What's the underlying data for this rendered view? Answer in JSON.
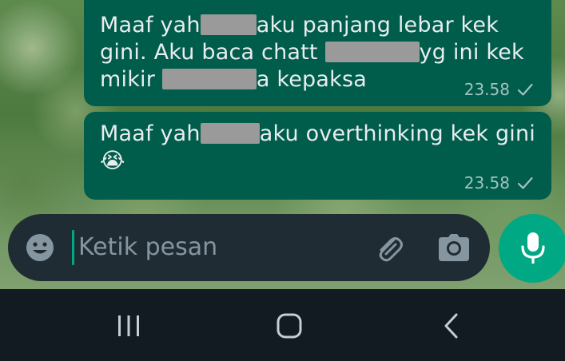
{
  "messages": [
    {
      "lines": [
        {
          "before": "Maaf yah",
          "after": "aku panjang lebar kek"
        },
        {
          "before": "gini. Aku baca chatt ",
          "after": "yg ini kek"
        },
        {
          "before": "mikir ",
          "after": "a kepaksa"
        }
      ],
      "time": "23.58",
      "status_icon": "single-check-icon"
    },
    {
      "lines": [
        {
          "before": "Maaf yah",
          "after": "aku overthinking kek gini"
        }
      ],
      "emoji": "😭",
      "time": "23.58",
      "status_icon": "single-check-icon"
    }
  ],
  "composer": {
    "placeholder": "Ketik pesan",
    "emoji_icon": "emoji-icon",
    "attach_icon": "paperclip-icon",
    "camera_icon": "camera-icon",
    "mic_icon": "microphone-icon"
  },
  "colors": {
    "bubble_outgoing": "#005c4b",
    "composer_bg": "#1f2c33",
    "accent": "#00a884",
    "navbar_bg": "#121b22"
  },
  "system_nav": {
    "recents_icon": "recents-icon",
    "home_icon": "home-icon",
    "back_icon": "back-icon"
  }
}
